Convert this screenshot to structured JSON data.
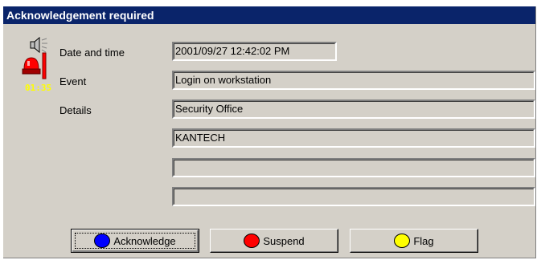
{
  "dialog": {
    "title": "Acknowledgement required"
  },
  "alarm": {
    "timer": "01:35"
  },
  "labels": {
    "date_time": "Date and time",
    "event": "Event",
    "details": "Details"
  },
  "fields": {
    "date_time": "2001/09/27 12:42:02 PM",
    "event": "Login on workstation",
    "details_1": "Security Office",
    "details_2": "KANTECH",
    "details_3": "",
    "details_4": ""
  },
  "buttons": {
    "acknowledge": "Acknowledge",
    "suspend": "Suspend",
    "flag": "Flag"
  },
  "colors": {
    "acknowledge_dot": "#0000ff",
    "suspend_dot": "#ff0000",
    "flag_dot": "#ffff00",
    "titlebar": "#0a246a"
  },
  "icons": {
    "alarm": "alarm-siren-icon"
  }
}
